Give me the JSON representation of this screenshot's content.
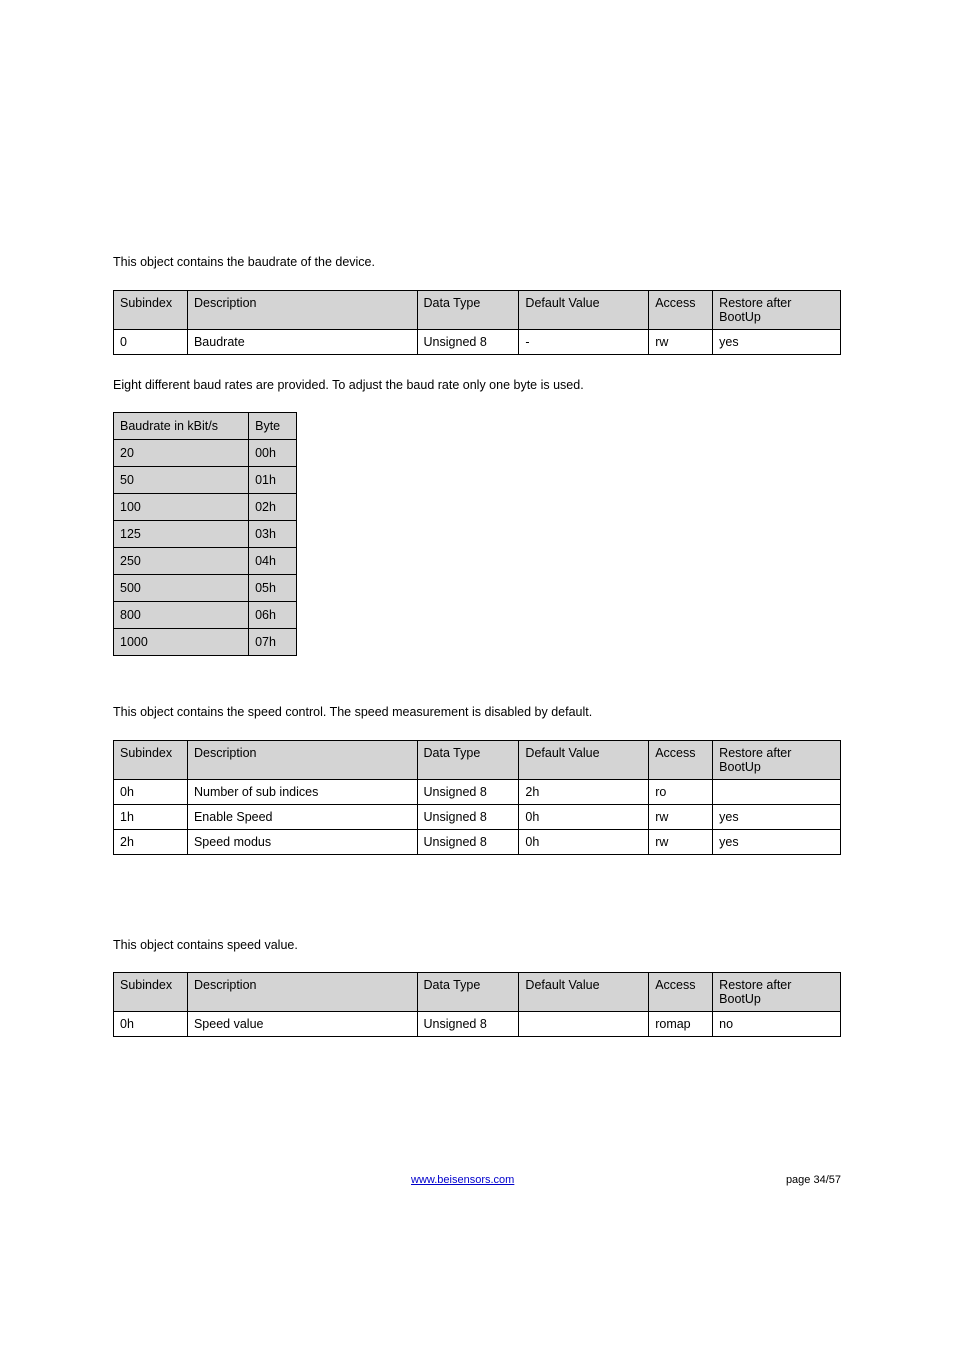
{
  "section1": {
    "intro": "This object contains the baudrate of the device.",
    "table": {
      "headers": {
        "subindex": "Subindex",
        "description": "Description",
        "datatype": "Data Type",
        "default": "Default Value",
        "access": "Access",
        "restore": "Restore after BootUp"
      },
      "rows": [
        {
          "subindex": "0",
          "description": "Baudrate",
          "datatype": "Unsigned 8",
          "default": "-",
          "access": "rw",
          "restore": "yes"
        }
      ]
    },
    "note": "Eight different baud rates are provided. To adjust the baud rate only one byte is used."
  },
  "baud_table": {
    "headers": {
      "rate": "Baudrate in kBit/s",
      "byte": "Byte"
    },
    "rows": [
      {
        "rate": "20",
        "byte": "00h"
      },
      {
        "rate": "50",
        "byte": "01h"
      },
      {
        "rate": "100",
        "byte": "02h"
      },
      {
        "rate": "125",
        "byte": "03h"
      },
      {
        "rate": "250",
        "byte": "04h"
      },
      {
        "rate": "500",
        "byte": "05h"
      },
      {
        "rate": "800",
        "byte": "06h"
      },
      {
        "rate": "1000",
        "byte": "07h"
      }
    ]
  },
  "section2": {
    "intro": "This object contains the speed control. The speed measurement is disabled by default.",
    "table": {
      "rows": [
        {
          "subindex": "0h",
          "description": "Number of sub indices",
          "datatype": "Unsigned 8",
          "default": "2h",
          "access": "ro",
          "restore": ""
        },
        {
          "subindex": "1h",
          "description": "Enable Speed",
          "datatype": "Unsigned 8",
          "default": "0h",
          "access": "rw",
          "restore": "yes"
        },
        {
          "subindex": "2h",
          "description": "Speed modus",
          "datatype": "Unsigned 8",
          "default": "0h",
          "access": "rw",
          "restore": "yes"
        }
      ]
    }
  },
  "section3": {
    "intro": "This object contains speed value.",
    "table": {
      "rows": [
        {
          "subindex": "0h",
          "description": "Speed value",
          "datatype": "Unsigned 8",
          "default": "",
          "access": "romap",
          "restore": "no"
        }
      ]
    }
  },
  "footer": {
    "link": "www.beisensors.com",
    "page": "page 34/57"
  }
}
